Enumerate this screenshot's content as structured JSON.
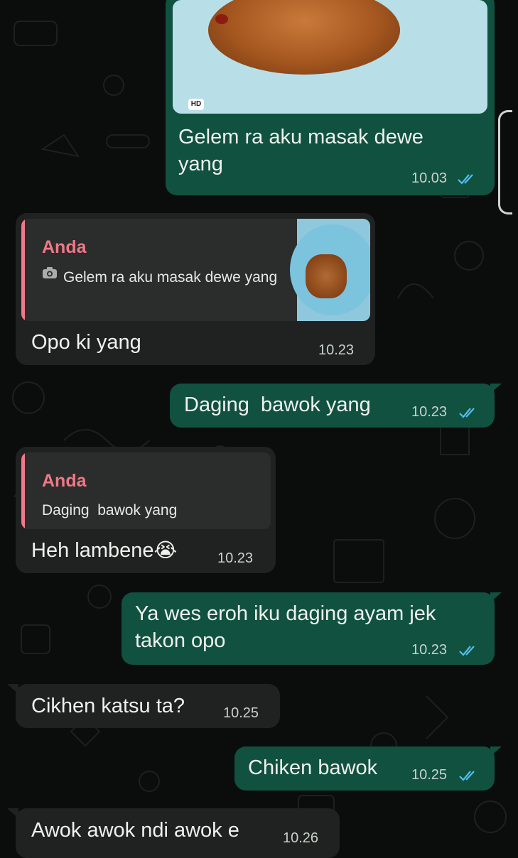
{
  "messages": [
    {
      "id": "m1",
      "direction": "outgoing",
      "media": {
        "type": "photo",
        "hd_badge": "HD"
      },
      "text": "Gelem ra aku masak dewe yang",
      "time": "10.03",
      "status_icon": "double-check-read"
    },
    {
      "id": "m2",
      "direction": "incoming",
      "quote": {
        "author": "Anda",
        "icon": "camera-icon",
        "text": "Gelem ra aku masak dewe yang",
        "has_thumbnail": true
      },
      "text": "Opo ki yang",
      "time": "10.23"
    },
    {
      "id": "m3",
      "direction": "outgoing",
      "text": "Daging  bawok yang",
      "time": "10.23",
      "status_icon": "double-check-read"
    },
    {
      "id": "m4",
      "direction": "incoming",
      "quote": {
        "author": "Anda",
        "text": "Daging  bawok yang"
      },
      "text": "Heh lambene",
      "emoji": "😭",
      "time": "10.23"
    },
    {
      "id": "m5",
      "direction": "outgoing",
      "text": "Ya wes eroh iku daging ayam jek takon opo",
      "time": "10.23",
      "status_icon": "double-check-read"
    },
    {
      "id": "m6",
      "direction": "incoming",
      "text": "Cikhen katsu ta?",
      "time": "10.25"
    },
    {
      "id": "m7",
      "direction": "outgoing",
      "text": "Chiken bawok",
      "time": "10.25",
      "status_icon": "double-check-read"
    },
    {
      "id": "m8",
      "direction": "incoming",
      "text": "Awok awok ndi awok e",
      "time": "10.26"
    }
  ],
  "colors": {
    "outgoing_bubble": "#11513f",
    "incoming_bubble": "#1f2220",
    "quote_accent": "#f07889",
    "read_ticks": "#53bdeb",
    "background": "#0b0d0c"
  }
}
